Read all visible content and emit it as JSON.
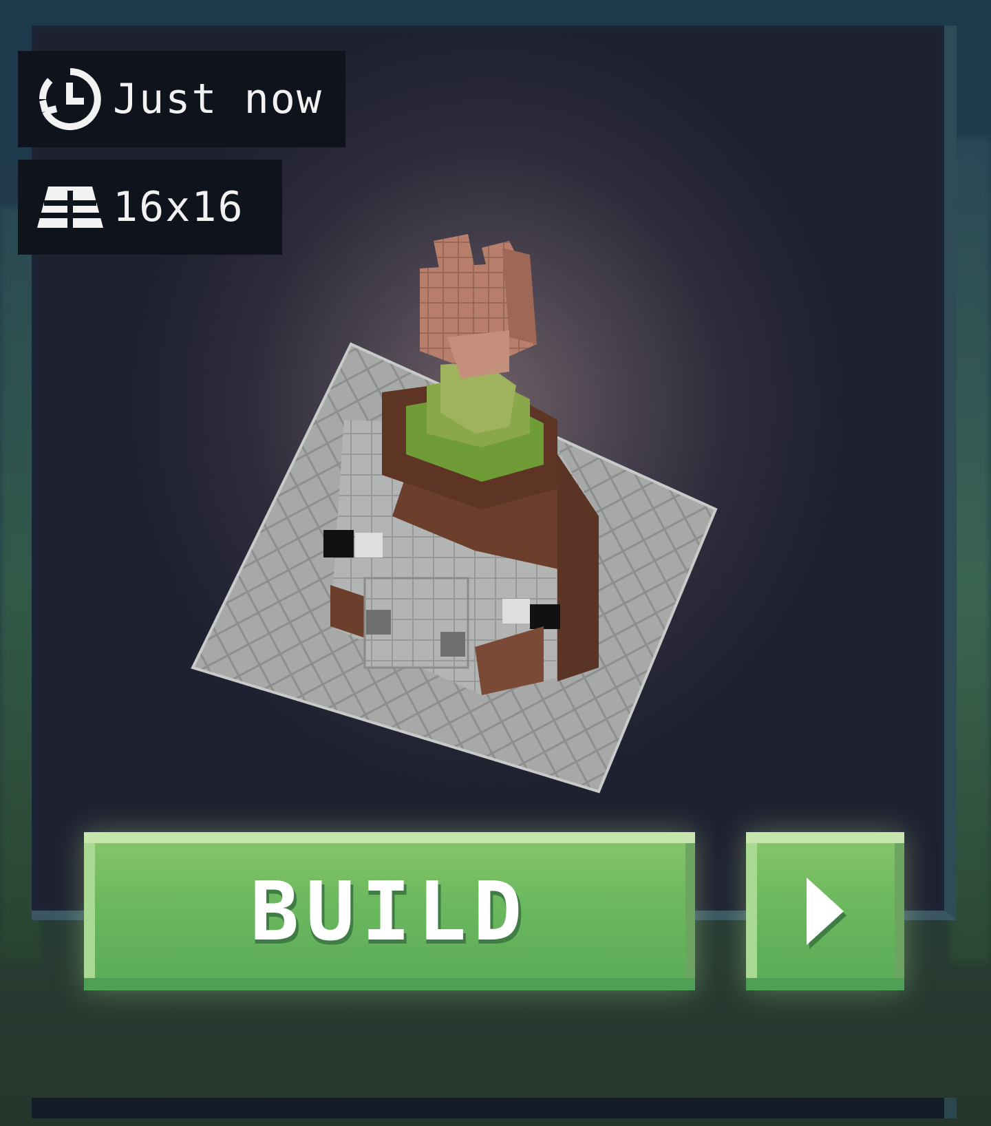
{
  "badges": {
    "time": {
      "icon": "history-clock-icon",
      "text": "Just now"
    },
    "size": {
      "icon": "floor-grid-icon",
      "text": "16x16"
    }
  },
  "model": {
    "icon": "voxel-build-preview"
  },
  "actions": {
    "build_label": "BUILD",
    "next_icon": "play-arrow-icon"
  },
  "colors": {
    "button_green": "#6bb85e",
    "button_highlight": "#c6e6ae",
    "badge_bg": "#0f131b",
    "text": "#f2f2f2"
  }
}
